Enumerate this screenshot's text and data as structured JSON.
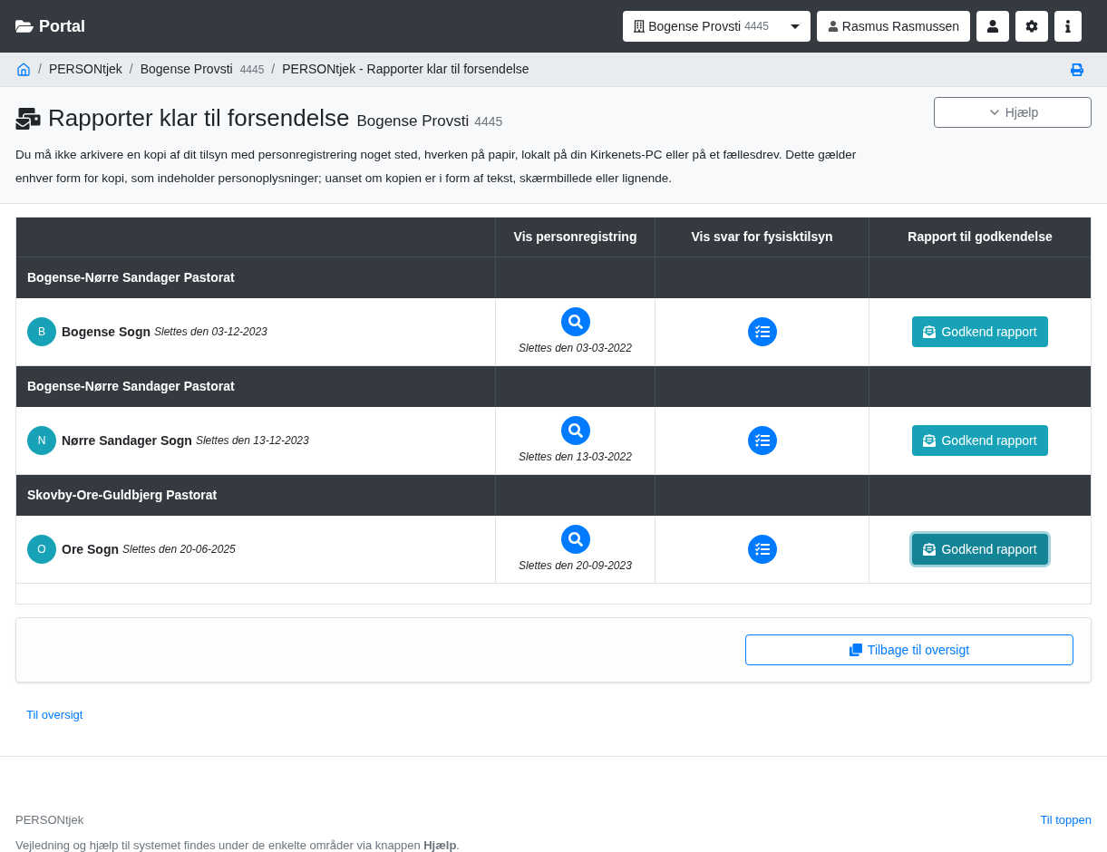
{
  "navbar": {
    "brand": "Portal",
    "org_select": {
      "name": "Bogense Provsti",
      "code": "4445"
    },
    "user": "Rasmus Rasmussen"
  },
  "breadcrumb_separator": "/",
  "breadcrumb": [
    {
      "label": "PERSONtjek"
    },
    {
      "label": "Bogense Provsti",
      "code": "4445"
    },
    {
      "label": "PERSONtjek - Rapporter klar til forsendelse"
    }
  ],
  "header": {
    "title": "Rapporter klar til forsendelse",
    "subtitle": "Bogense Provsti",
    "code": "4445",
    "help_button": "Hjælp",
    "notice": "Du må ikke arkivere en kopi af dit tilsyn med personregistrering noget sted, hverken på papir, lokalt på din Kirkenets-PC eller på et fællesdrev. Dette gælder enhver form for kopi, som indeholder personoplysninger; uanset om kopien er i form af tekst, skærmbillede eller lignende."
  },
  "table": {
    "columns": [
      "Vis personregistring",
      "Vis svar for fysisktilsyn",
      "Rapport til godkendelse"
    ],
    "groups": [
      {
        "name": "Bogense-Nørre Sandager Pastorat",
        "rows": [
          {
            "initial": "B",
            "name": "Bogense Sogn",
            "delete_note": "Slettes den 03-12-2023",
            "registration_note": "Slettes den 03-03-2022",
            "approve_button": "Godkend rapport",
            "focused": false
          }
        ]
      },
      {
        "name": "Bogense-Nørre Sandager Pastorat",
        "rows": [
          {
            "initial": "N",
            "name": "Nørre Sandager Sogn",
            "delete_note": "Slettes den 13-12-2023",
            "registration_note": "Slettes den 13-03-2022",
            "approve_button": "Godkend rapport",
            "focused": false
          }
        ]
      },
      {
        "name": "Skovby-Ore-Guldbjerg Pastorat",
        "rows": [
          {
            "initial": "O",
            "name": "Ore Sogn",
            "delete_note": "Slettes den 20-06-2025",
            "registration_note": "Slettes den 20-09-2023",
            "approve_button": "Godkend rapport",
            "focused": true
          }
        ]
      }
    ]
  },
  "back_button": "Tilbage til oversigt",
  "overview_link": "Til oversigt",
  "footer": {
    "app": "PERSONtjek",
    "help_text": "Vejledning og hjælp til systemet findes under de enkelte områder via knappen **Hjælp**.",
    "top_link": "Til toppen"
  }
}
